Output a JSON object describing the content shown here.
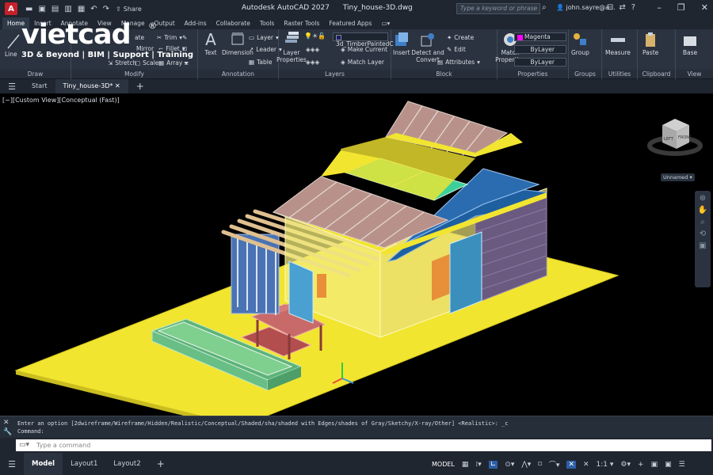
{
  "titlebar": {
    "app_letter": "A",
    "share_label": "Share",
    "app_name": "Autodesk AutoCAD 2027",
    "file_name": "Tiny_house-3D.dwg",
    "search_placeholder": "Type a keyword or phrase",
    "user": "john.sayre@a..."
  },
  "ribbon_tabs": [
    "Home",
    "Insert",
    "Annotate",
    "View",
    "Manage",
    "Output",
    "Add-ins",
    "Collaborate",
    "Tools",
    "Raster Tools",
    "Featured Apps"
  ],
  "brand": {
    "name": "vietcad",
    "reg": "®",
    "tagline": "3D & Beyond | BIM | Support | Training"
  },
  "ribbon": {
    "draw": {
      "label": "Draw",
      "line": "Line"
    },
    "modify": {
      "label": "Modify",
      "trim": "Trim",
      "fillet": "Fillet",
      "array": "Array",
      "stretch": "Stretch",
      "scale": "Scale",
      "mirror": "Mirror",
      "rotate": "ate"
    },
    "annotation": {
      "label": "Annotation",
      "text": "Text",
      "dimension": "Dimension",
      "leader": "Leader",
      "table": "Table",
      "layer_dd": "Layer"
    },
    "layers": {
      "label": "Layers",
      "layer_properties": "Layer Properties",
      "current_layer": "3d_TimberPaintedC",
      "make_current": "Make Current",
      "match_layer": "Match Layer"
    },
    "block": {
      "label": "Block",
      "insert": "Insert",
      "detect": "Detect and Convert",
      "create": "Create",
      "edit": "Edit",
      "attributes": "Attributes"
    },
    "properties": {
      "label": "Properties",
      "match": "Match Properties",
      "color": "Magenta",
      "linetype": "ByLayer",
      "lineweight": "ByLayer"
    },
    "groups": {
      "label": "Groups",
      "group": "Group"
    },
    "utilities": {
      "label": "Utilities",
      "measure": "Measure"
    },
    "clipboard": {
      "label": "Clipboard",
      "paste": "Paste"
    },
    "view": {
      "label": "View",
      "base": "Base"
    }
  },
  "file_tabs": {
    "start": "Start",
    "active": "Tiny_house-3D*"
  },
  "viewport": {
    "label": "[−][Custom View][Conceptual (Fast)]",
    "viewcube_left": "LEFT",
    "viewcube_front": "FRONT",
    "ucs_label": "Unnamed"
  },
  "command": {
    "history_line": "Enter an option [2dwireframe/Wireframe/Hidden/Realistic/Conceptual/Shaded/sha/shaded with Edges/shades of Gray/Sketchy/X-ray/Other] <Realistic>: _c",
    "prompt_line": "Command:",
    "placeholder": "Type a command"
  },
  "status": {
    "tabs": [
      "Model",
      "Layout1",
      "Layout2"
    ],
    "mode": "MODEL",
    "scale": "1:1"
  },
  "colors": {
    "ground": "#f2e530",
    "roof_tiles": "#b8928a",
    "wall_blue": "#1e5fa0",
    "wood": "#e0c090",
    "bench_red": "#b34e4e",
    "planter_green": "#7fcf8f"
  }
}
